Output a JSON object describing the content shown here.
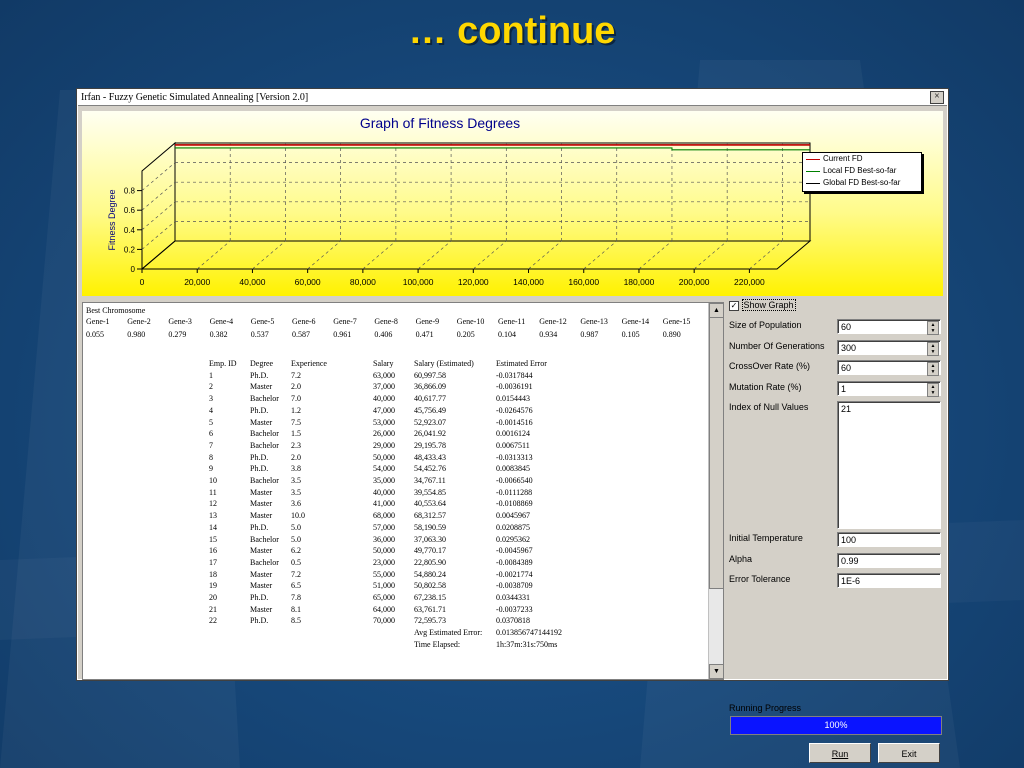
{
  "slide": {
    "title": "… continue"
  },
  "window": {
    "title": "Irfan - Fuzzy Genetic Simulated Annealing [Version 2.0]",
    "close_glyph": "×"
  },
  "chart_data": {
    "type": "line",
    "title": "Graph of Fitness Degrees",
    "ylabel": "Fitness Degree",
    "xlabel": "",
    "xlim": [
      0,
      230000
    ],
    "ylim": [
      0,
      1
    ],
    "x_ticks": [
      "0",
      "20,000",
      "40,000",
      "60,000",
      "80,000",
      "100,000",
      "120,000",
      "140,000",
      "160,000",
      "180,000",
      "200,000",
      "220,000"
    ],
    "y_ticks": [
      "0",
      "0.2",
      "0.4",
      "0.6",
      "0.8"
    ],
    "legend_position": "top-right",
    "grid": true,
    "series": [
      {
        "name": "Current FD",
        "color": "#c00000",
        "x": [
          0,
          230000
        ],
        "y": [
          0.98,
          0.98
        ]
      },
      {
        "name": "Local FD Best-so-far",
        "color": "#008000",
        "x": [
          0,
          180000,
          180000,
          230000
        ],
        "y": [
          0.95,
          0.95,
          0.93,
          0.93
        ]
      },
      {
        "name": "Global FD Best-so-far",
        "color": "#000000",
        "x": [
          0,
          230000
        ],
        "y": [
          0.98,
          0.98
        ]
      }
    ]
  },
  "best_chromosome": {
    "title": "Best Chromosome",
    "genes": [
      "Gene-1",
      "Gene-2",
      "Gene-3",
      "Gene-4",
      "Gene-5",
      "Gene-6",
      "Gene-7",
      "Gene-8",
      "Gene-9",
      "Gene-10",
      "Gene-11",
      "Gene-12",
      "Gene-13",
      "Gene-14",
      "Gene-15"
    ],
    "values": [
      "0.055",
      "0.980",
      "0.279",
      "0.382",
      "0.537",
      "0.587",
      "0.961",
      "0.406",
      "0.471",
      "0.205",
      "0.104",
      "0.934",
      "0.987",
      "0.105",
      "0.890"
    ]
  },
  "employees": {
    "headers": [
      "Emp. ID",
      "Degree",
      "Experience",
      "Salary",
      "Salary (Estimated)",
      "Estimated Error"
    ],
    "rows": [
      [
        "1",
        "Ph.D.",
        "7.2",
        "63,000",
        "60,997.58",
        "-0.0317844"
      ],
      [
        "2",
        "Master",
        "2.0",
        "37,000",
        "36,866.09",
        "-0.0036191"
      ],
      [
        "3",
        "Bachelor",
        "7.0",
        "40,000",
        "40,617.77",
        "0.0154443"
      ],
      [
        "4",
        "Ph.D.",
        "1.2",
        "47,000",
        "45,756.49",
        "-0.0264576"
      ],
      [
        "5",
        "Master",
        "7.5",
        "53,000",
        "52,923.07",
        "-0.0014516"
      ],
      [
        "6",
        "Bachelor",
        "1.5",
        "26,000",
        "26,041.92",
        "0.0016124"
      ],
      [
        "7",
        "Bachelor",
        "2.3",
        "29,000",
        "29,195.78",
        "0.0067511"
      ],
      [
        "8",
        "Ph.D.",
        "2.0",
        "50,000",
        "48,433.43",
        "-0.0313313"
      ],
      [
        "9",
        "Ph.D.",
        "3.8",
        "54,000",
        "54,452.76",
        "0.0083845"
      ],
      [
        "10",
        "Bachelor",
        "3.5",
        "35,000",
        "34,767.11",
        "-0.0066540"
      ],
      [
        "11",
        "Master",
        "3.5",
        "40,000",
        "39,554.85",
        "-0.0111288"
      ],
      [
        "12",
        "Master",
        "3.6",
        "41,000",
        "40,553.64",
        "-0.0108869"
      ],
      [
        "13",
        "Master",
        "10.0",
        "68,000",
        "68,312.57",
        "0.0045967"
      ],
      [
        "14",
        "Ph.D.",
        "5.0",
        "57,000",
        "58,190.59",
        "0.0208875"
      ],
      [
        "15",
        "Bachelor",
        "5.0",
        "36,000",
        "37,063.30",
        "0.0295362"
      ],
      [
        "16",
        "Master",
        "6.2",
        "50,000",
        "49,770.17",
        "-0.0045967"
      ],
      [
        "17",
        "Bachelor",
        "0.5",
        "23,000",
        "22,805.90",
        "-0.0084389"
      ],
      [
        "18",
        "Master",
        "7.2",
        "55,000",
        "54,880.24",
        "-0.0021774"
      ],
      [
        "19",
        "Master",
        "6.5",
        "51,000",
        "50,802.58",
        "-0.0038709"
      ],
      [
        "20",
        "Ph.D.",
        "7.8",
        "65,000",
        "67,238.15",
        "0.0344331"
      ],
      [
        "21",
        "Master",
        "8.1",
        "64,000",
        "63,761.71",
        "-0.0037233"
      ],
      [
        "22",
        "Ph.D.",
        "8.5",
        "70,000",
        "72,595.73",
        "0.0370818"
      ]
    ],
    "avg_label": "Avg Estimated Error:",
    "avg_value": "0.013856747144192",
    "time_label": "Time Elapsed:",
    "time_value": "1h:37m:31s:750ms"
  },
  "settings": {
    "show_graph_label": "Show Graph",
    "show_graph_checked": true,
    "population_label": "Size of Population",
    "population_value": "60",
    "generations_label": "Number Of Generations",
    "generations_value": "300",
    "crossover_label": "CrossOver Rate (%)",
    "crossover_value": "60",
    "mutation_label": "Mutation Rate (%)",
    "mutation_value": "1",
    "null_label": "Index of Null Values",
    "null_value": "21",
    "temp_label": "Initial Temperature",
    "temp_value": "100",
    "alpha_label": "Alpha",
    "alpha_value": "0.99",
    "tolerance_label": "Error Tolerance",
    "tolerance_value": "1E-6",
    "progress_label": "Running Progress",
    "progress_text": "100%",
    "progress_fraction": 1.0,
    "run_label": "Run",
    "exit_label": "Exit"
  }
}
